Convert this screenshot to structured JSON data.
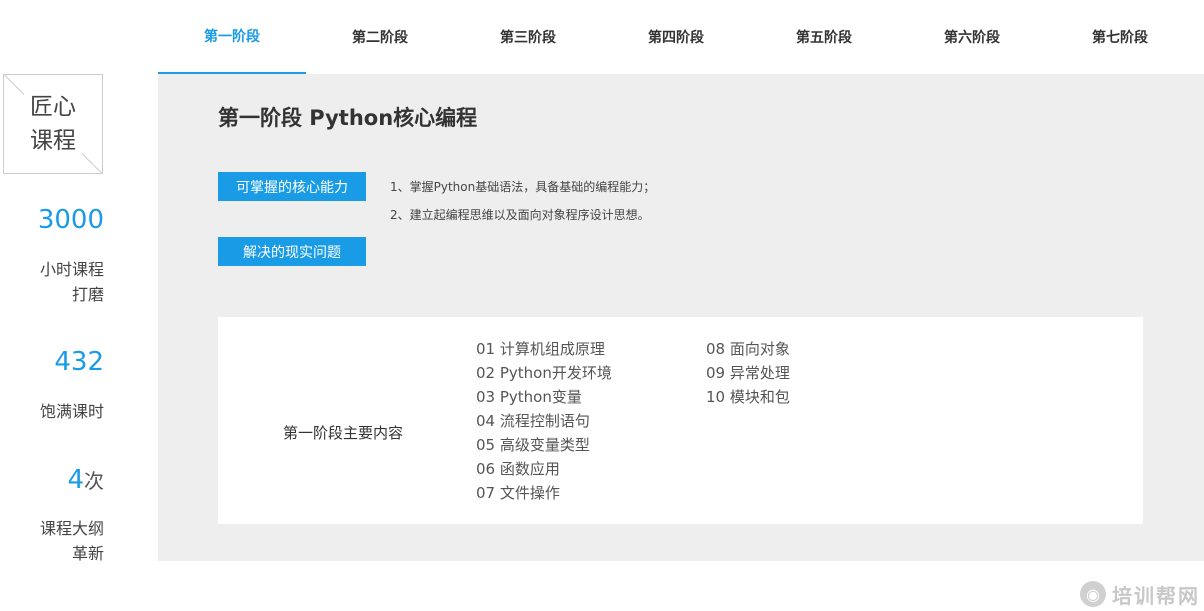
{
  "tabs": [
    {
      "label": "第一阶段",
      "active": true
    },
    {
      "label": "第二阶段",
      "active": false
    },
    {
      "label": "第三阶段",
      "active": false
    },
    {
      "label": "第四阶段",
      "active": false
    },
    {
      "label": "第五阶段",
      "active": false
    },
    {
      "label": "第六阶段",
      "active": false
    },
    {
      "label": "第七阶段",
      "active": false
    }
  ],
  "sidebar": {
    "logo_line1": "匠心",
    "logo_line2": "课程",
    "stats": [
      {
        "value": "3000",
        "label_line1": "小时课程",
        "label_line2": "打磨"
      },
      {
        "value": "432",
        "label_line1": "饱满课时",
        "label_line2": ""
      },
      {
        "value": "4",
        "unit": "次",
        "label_line1": "课程大纲",
        "label_line2": "革新"
      }
    ]
  },
  "main": {
    "title": "第一阶段 Python核心编程",
    "core_ability_button": "可掌握的核心能力",
    "real_problem_button": "解决的现实问题",
    "abilities": [
      "1、掌握Python基础语法，具备基础的编程能力；",
      "2、建立起编程思维以及面向对象程序设计思想。"
    ],
    "content_label": "第一阶段主要内容",
    "content_col1": [
      "01 计算机组成原理",
      "02 Python开发环境",
      "03 Python变量",
      "04 流程控制语句",
      "05 高级变量类型",
      "06 函数应用",
      "07 文件操作"
    ],
    "content_col2": [
      "08 面向对象",
      "09 异常处理",
      "10 模块和包"
    ]
  },
  "watermark": {
    "text": "培训帮网",
    "icon": "eye-logo-icon"
  },
  "colors": {
    "accent": "#1a9be6",
    "panel_bg": "#eeeeee"
  }
}
